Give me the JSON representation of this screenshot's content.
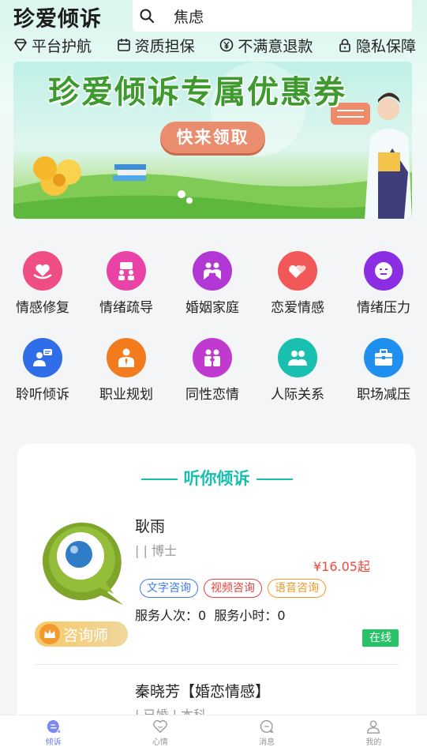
{
  "header": {
    "app_title": "珍爱倾诉",
    "search_value": "焦虑",
    "badges": [
      "平台护航",
      "资质担保",
      "不满意退款",
      "隐私保障"
    ]
  },
  "banner": {
    "title": "珍爱倾诉专属优惠券",
    "cta": "快来领取"
  },
  "categories": [
    {
      "label": "情感修复",
      "color": "#ee4e84"
    },
    {
      "label": "情绪疏导",
      "color": "#e943a8"
    },
    {
      "label": "婚姻家庭",
      "color": "#b238d6"
    },
    {
      "label": "恋爱情感",
      "color": "#f25858"
    },
    {
      "label": "情绪压力",
      "color": "#8a2de3"
    },
    {
      "label": "聆听倾诉",
      "color": "#2f6ee8"
    },
    {
      "label": "职业规划",
      "color": "#f27b1e"
    },
    {
      "label": "同性恋情",
      "color": "#c03ad0"
    },
    {
      "label": "人际关系",
      "color": "#19c0b0"
    },
    {
      "label": "职场减压",
      "color": "#1f8ff0"
    }
  ],
  "section": {
    "title": "听你倾诉"
  },
  "counselors": [
    {
      "name": "耿雨",
      "degree": "| | 博士",
      "price": "¥16.05起",
      "tags": [
        "文字咨询",
        "视频咨询",
        "语音咨询"
      ],
      "stats": "服务人次：0  服务小时：0",
      "role": "咨询师",
      "status": "在线"
    },
    {
      "name": "秦晓芳【婚恋情感】",
      "sub": "| 已婚 | 本科"
    }
  ],
  "tabbar": {
    "items": [
      "倾诉",
      "心情",
      "消息",
      "我的"
    ],
    "active_color": "#6b78ee"
  }
}
